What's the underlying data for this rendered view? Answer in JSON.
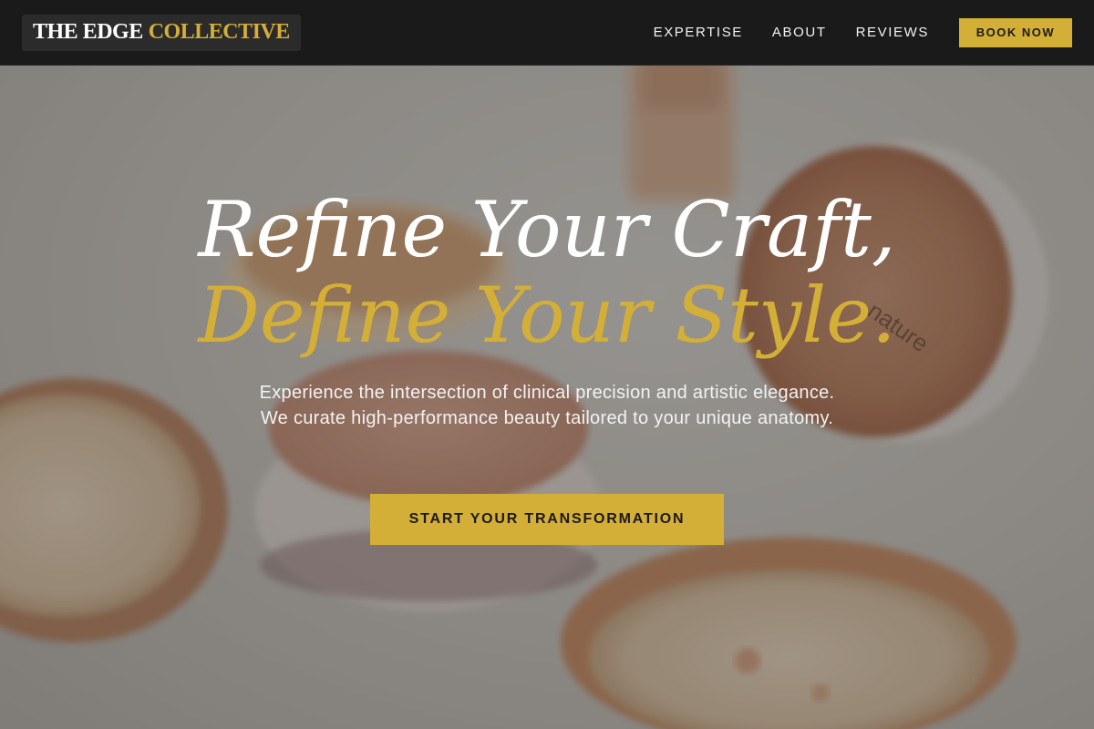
{
  "brand": {
    "logo_part_1": "THE EDGE",
    "logo_part_2": "COLLECTIVE"
  },
  "nav": {
    "links": [
      {
        "label": "EXPERTISE"
      },
      {
        "label": "ABOUT"
      },
      {
        "label": "REVIEWS"
      }
    ],
    "book_label": "BOOK NOW"
  },
  "hero": {
    "headline_line_1": "Refine Your Craft,",
    "headline_line_2": "Define Your Style.",
    "subtext": "Experience the intersection of clinical precision and artistic elegance. We curate high-performance beauty tailored to your unique anatomy.",
    "cta_label": "START YOUR TRANSFORMATION"
  },
  "colors": {
    "nav_background": "#1a1a1a",
    "accent_gold": "#d4af37",
    "text_light": "#ffffff"
  }
}
